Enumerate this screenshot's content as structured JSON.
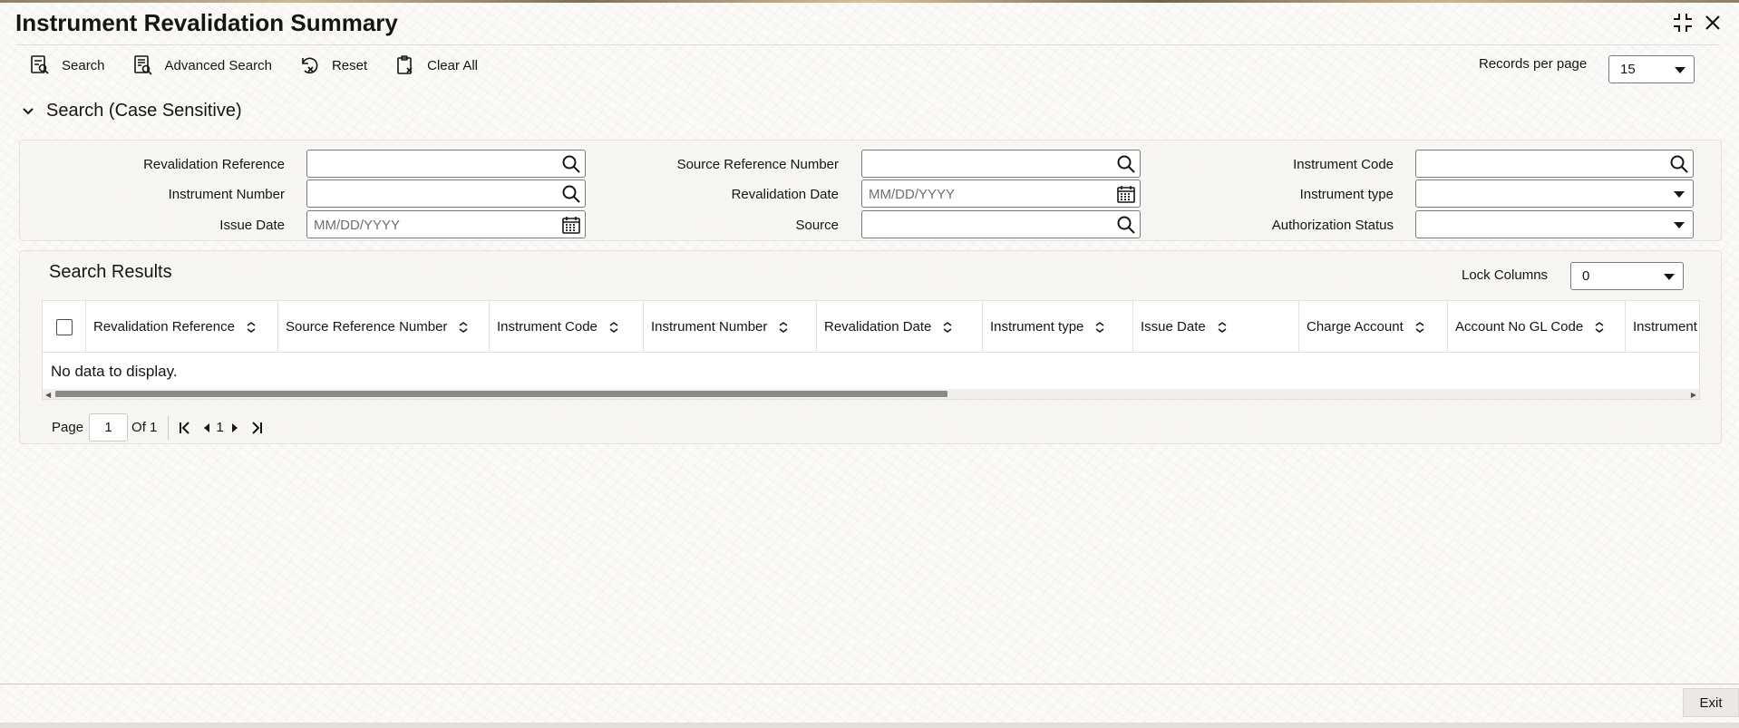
{
  "window": {
    "title": "Instrument Revalidation Summary"
  },
  "toolbar": {
    "search_label": "Search",
    "advanced_search_label": "Advanced Search",
    "reset_label": "Reset",
    "clear_all_label": "Clear All"
  },
  "records_per_page": {
    "label": "Records per page",
    "value": "15"
  },
  "search_section": {
    "title": "Search (Case Sensitive)",
    "fields": {
      "revalidation_reference": {
        "label": "Revalidation Reference",
        "value": ""
      },
      "source_reference_number": {
        "label": "Source Reference Number",
        "value": ""
      },
      "instrument_code": {
        "label": "Instrument Code",
        "value": ""
      },
      "instrument_number": {
        "label": "Instrument Number",
        "value": ""
      },
      "revalidation_date": {
        "label": "Revalidation Date",
        "placeholder": "MM/DD/YYYY"
      },
      "instrument_type": {
        "label": "Instrument type",
        "value": ""
      },
      "issue_date": {
        "label": "Issue Date",
        "placeholder": "MM/DD/YYYY"
      },
      "source": {
        "label": "Source",
        "value": ""
      },
      "authorization_status": {
        "label": "Authorization Status",
        "value": ""
      }
    }
  },
  "results": {
    "title": "Search Results",
    "lock_columns_label": "Lock Columns",
    "lock_columns_value": "0",
    "columns": [
      "Revalidation Reference",
      "Source Reference Number",
      "Instrument Code",
      "Instrument Number",
      "Revalidation Date",
      "Instrument type",
      "Issue Date",
      "Charge Account",
      "Account No GL Code",
      "Instrument"
    ],
    "empty_message": "No data to display."
  },
  "pagination": {
    "page_label": "Page",
    "current_page": "1",
    "of_label": "Of 1",
    "page_number": "1"
  },
  "footer": {
    "exit_label": "Exit"
  }
}
